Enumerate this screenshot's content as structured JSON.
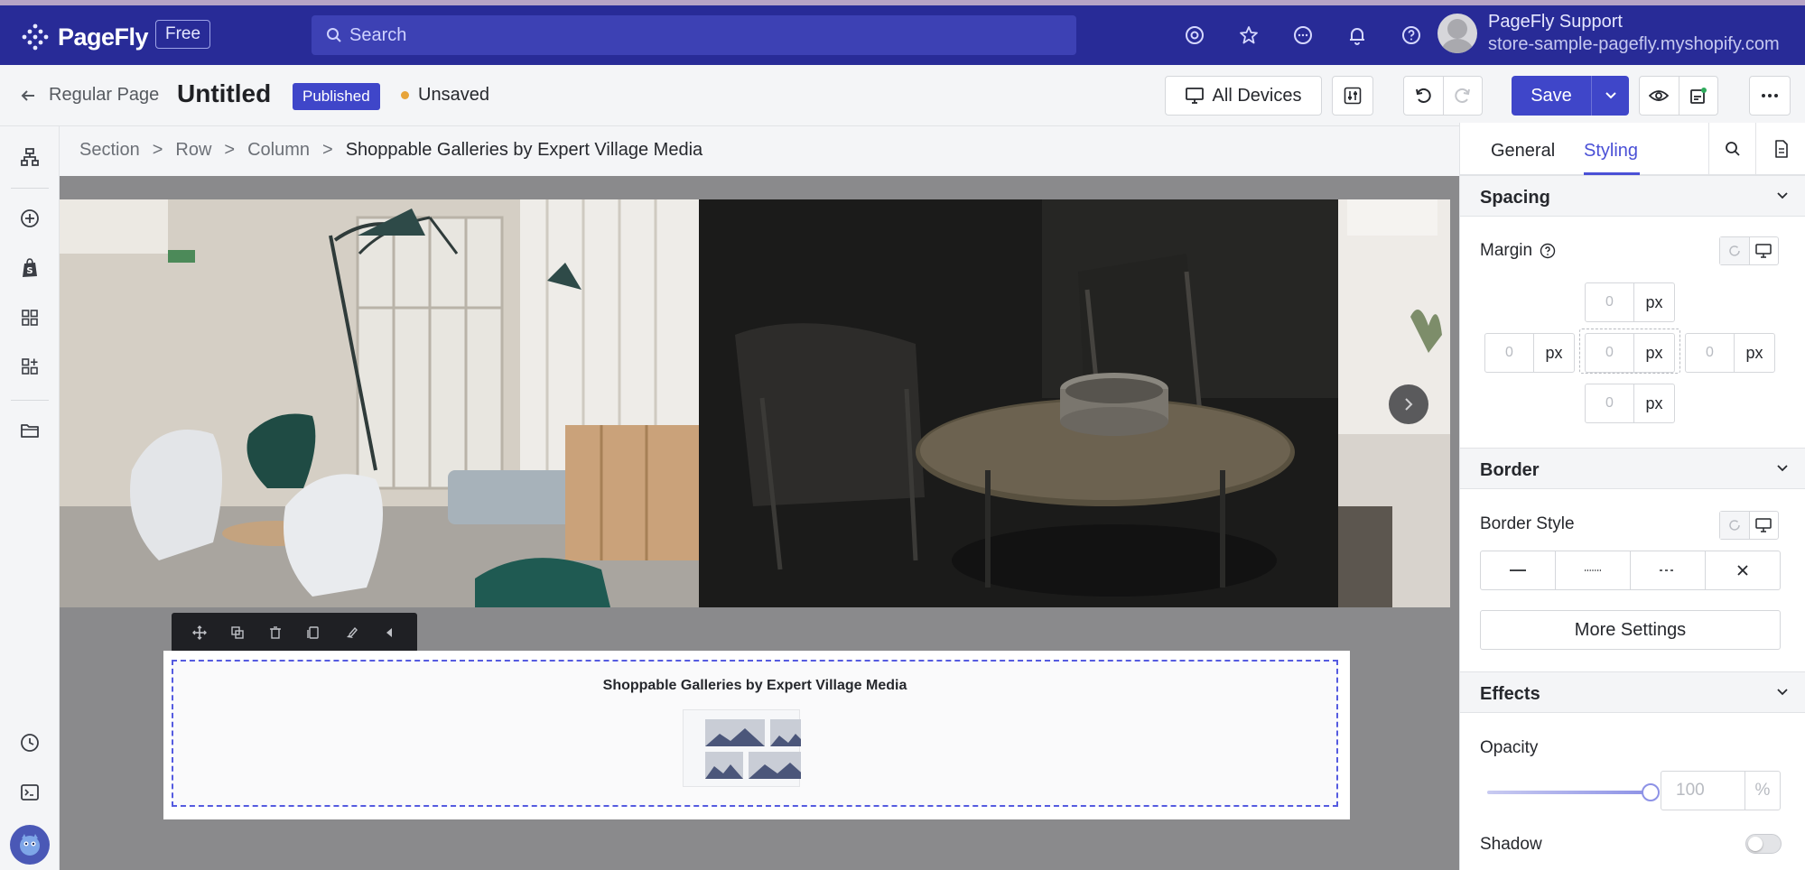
{
  "colors": {
    "topbar": "#282b97",
    "accent": "#3f46c9",
    "styling_tab": "#4a50d6",
    "unsaved_dot": "#e7a43a"
  },
  "topbar": {
    "brand": "PageFly",
    "plan_badge": "Free",
    "search_placeholder": "Search",
    "icons": [
      "target-icon",
      "star-icon",
      "chat-icon",
      "bell-icon",
      "help-icon"
    ],
    "user": {
      "name": "PageFly Support",
      "store": "store-sample-pagefly.myshopify.com"
    }
  },
  "subbar": {
    "back_label": "Regular Page",
    "page_title": "Untitled",
    "status_badge": "Published",
    "save_state": "Unsaved",
    "devices_label": "All Devices",
    "save_label": "Save"
  },
  "breadcrumb": {
    "items": [
      "Section",
      "Row",
      "Column"
    ],
    "current": "Shoppable Galleries by Expert Village Media"
  },
  "element": {
    "title": "Shoppable Galleries by Expert Village Media"
  },
  "panel": {
    "tabs": {
      "general": "General",
      "styling": "Styling"
    },
    "spacing": {
      "header": "Spacing",
      "margin_label": "Margin",
      "unit": "px",
      "top": "0",
      "left": "0",
      "center": "0",
      "right": "0",
      "bottom": "0"
    },
    "border": {
      "header": "Border",
      "style_label": "Border Style",
      "more_settings": "More Settings"
    },
    "effects": {
      "header": "Effects",
      "opacity_label": "Opacity",
      "opacity_value": "100",
      "opacity_unit": "%",
      "shadow_label": "Shadow",
      "shadow_enabled": false
    }
  }
}
